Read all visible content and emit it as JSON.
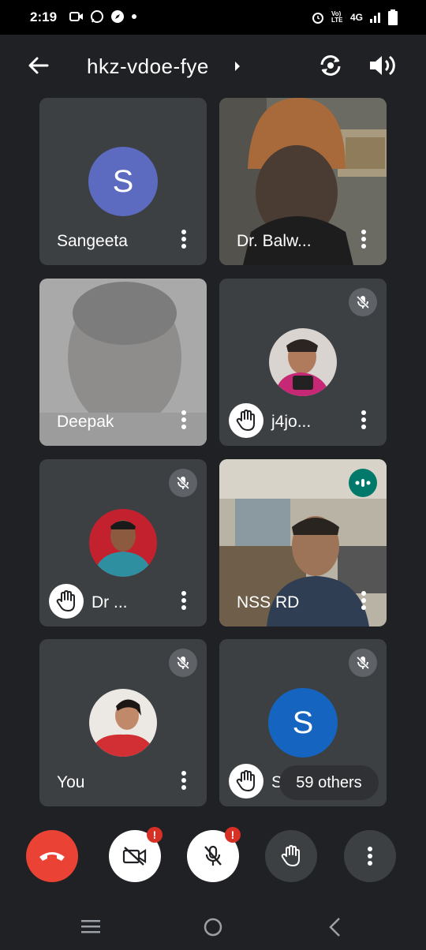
{
  "status_bar": {
    "time": "2:19",
    "network_label": "4G",
    "volte_label": "Vo) LTE"
  },
  "meeting": {
    "code": "hkz-vdoe-fye"
  },
  "participants": [
    {
      "name": "Sangeeta",
      "avatar_letter": "S",
      "avatar_color": "#5c6bc0",
      "muted": false,
      "hand_raised": false
    },
    {
      "name": "Dr. Balw...",
      "video": true,
      "muted": false,
      "hand_raised": false
    },
    {
      "name": "Deepak",
      "video": true,
      "muted": false,
      "hand_raised": false
    },
    {
      "name": "j4jo...",
      "photo": true,
      "muted": true,
      "hand_raised": true
    },
    {
      "name": "Dr ...",
      "photo": true,
      "muted": true,
      "hand_raised": true
    },
    {
      "name": "NSS RD",
      "video": true,
      "speaking": true,
      "hand_raised": false
    },
    {
      "name": "You",
      "photo": true,
      "muted": true,
      "hand_raised": false
    },
    {
      "name": "Sh...",
      "avatar_letter": "S",
      "avatar_color": "#1565c0",
      "muted": true,
      "hand_raised": true
    }
  ],
  "others_label": "59 others",
  "controls": {
    "end_call_color": "#ea4335",
    "camera_badge": "!",
    "mic_badge": "!"
  },
  "colors": {
    "background": "#202124",
    "tile": "#3c4043",
    "speaking_indicator": "#00796b",
    "alert_badge": "#d93025"
  }
}
